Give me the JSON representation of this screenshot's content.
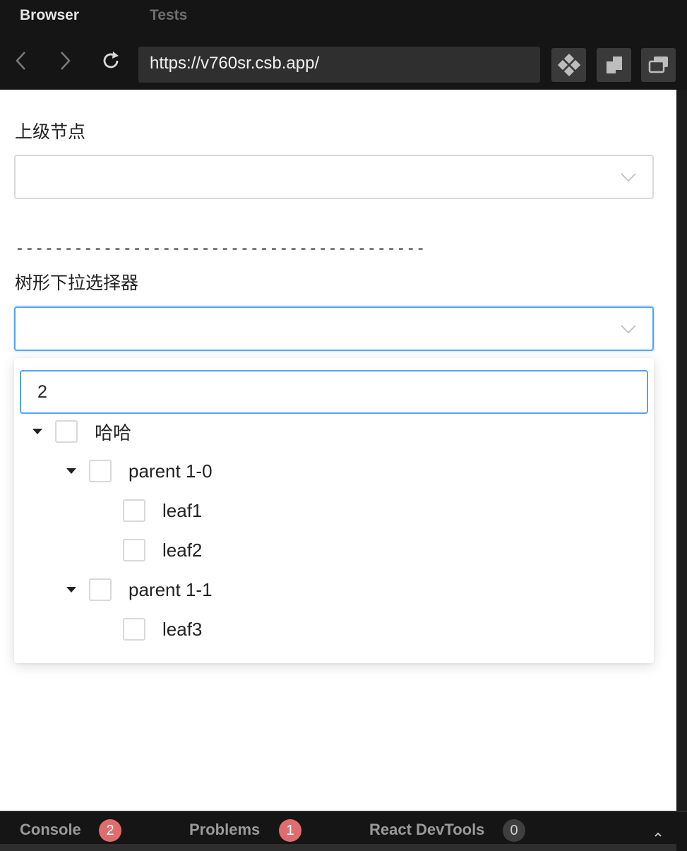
{
  "tabs": {
    "browser": "Browser",
    "tests": "Tests"
  },
  "navbar": {
    "url": "https://v760sr.csb.app/"
  },
  "page": {
    "parent_label": "上级节点",
    "divider": "------------------------------------------",
    "tree_label": "树形下拉选择器"
  },
  "dropdown": {
    "search_value": "2",
    "nodes": [
      {
        "label": "哈哈"
      },
      {
        "label": "parent 1-0"
      },
      {
        "label": "leaf1"
      },
      {
        "label": "leaf2"
      },
      {
        "label": "parent 1-1"
      },
      {
        "label": "leaf3"
      }
    ]
  },
  "devtools": {
    "console_label": "Console",
    "console_count": "2",
    "problems_label": "Problems",
    "problems_count": "1",
    "react_label": "React DevTools",
    "react_count": "0"
  },
  "colors": {
    "focus_blue": "#57a4ee",
    "badge_red": "#e06d6d",
    "chrome_dark": "#151515"
  }
}
